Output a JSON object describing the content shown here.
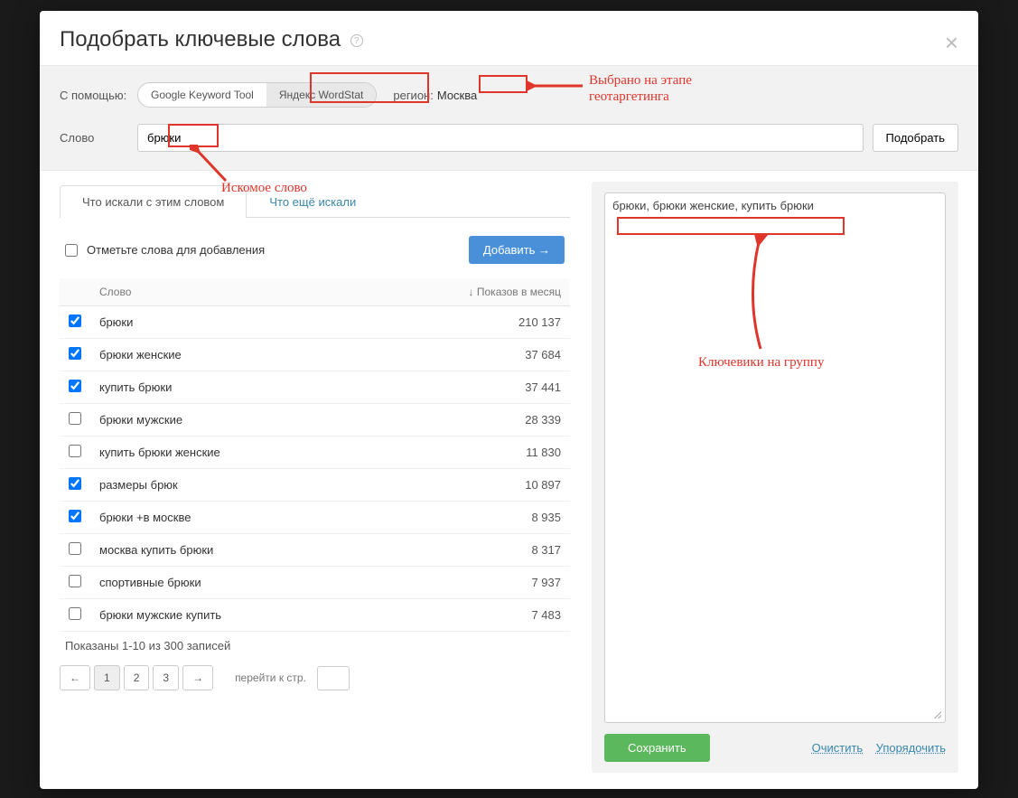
{
  "modal": {
    "title": "Подобрать ключевые слова",
    "with_label": "С помощью:",
    "tool1": "Google Keyword Tool",
    "tool2": "Яндекс WordStat",
    "region_label": "регион:",
    "region_value": "Москва",
    "word_label": "Слово",
    "word_value": "брюки",
    "pick_btn": "Подобрать"
  },
  "tabs": {
    "t1": "Что искали с этим словом",
    "t2": "Что ещё искали"
  },
  "addrow": {
    "hint": "Отметьте слова для добавления",
    "add_btn": "Добавить →"
  },
  "table": {
    "col_word": "Слово",
    "col_imps": "↓ Показов в месяц",
    "rows": [
      {
        "checked": true,
        "word": "брюки",
        "imps": "210 137"
      },
      {
        "checked": true,
        "word": "брюки женские",
        "imps": "37 684"
      },
      {
        "checked": true,
        "word": "купить брюки",
        "imps": "37 441"
      },
      {
        "checked": false,
        "word": "брюки мужские",
        "imps": "28 339"
      },
      {
        "checked": false,
        "word": "купить брюки женские",
        "imps": "11 830"
      },
      {
        "checked": true,
        "word": "размеры брюк",
        "imps": "10 897"
      },
      {
        "checked": true,
        "word": "брюки +в москве",
        "imps": "8 935"
      },
      {
        "checked": false,
        "word": "москва купить брюки",
        "imps": "8 317"
      },
      {
        "checked": false,
        "word": "спортивные брюки",
        "imps": "7 937"
      },
      {
        "checked": false,
        "word": "брюки мужские купить",
        "imps": "7 483"
      }
    ]
  },
  "pager": {
    "summary": "Показаны 1-10 из 300 записей",
    "prev": "←",
    "p1": "1",
    "p2": "2",
    "p3": "3",
    "next": "→",
    "goto": "перейти к стр."
  },
  "right": {
    "keywords": "брюки, брюки женские, купить брюки",
    "save": "Сохранить",
    "clear": "Очистить",
    "order": "Упорядочить"
  },
  "annotations": {
    "geo1": "Выбрано на этапе",
    "geo2": "геотаргетинга",
    "search": "Искомое слово",
    "group": "Ключевики на группу"
  }
}
